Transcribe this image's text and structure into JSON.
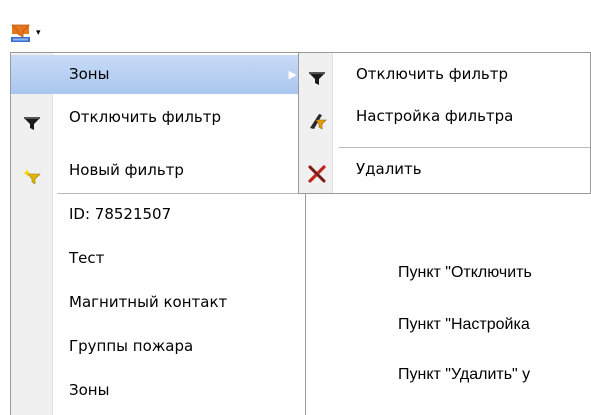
{
  "toolbar": {
    "filter_button_icon": "filter-dropdown-icon",
    "dropdown_arrow": "▾"
  },
  "main_menu": {
    "items": [
      {
        "label": "Зоны",
        "icon": "",
        "submenu_arrow": "▶",
        "active": true
      },
      {
        "label": "Отключить фильтр",
        "icon": "funnel-icon"
      },
      {
        "label": "Новый фильтр",
        "icon": "new-filter-icon"
      },
      {
        "label": "ID: 78521507",
        "icon": ""
      },
      {
        "label": "Тест",
        "icon": ""
      },
      {
        "label": "Магнитный контакт",
        "icon": ""
      },
      {
        "label": "Группы пожара",
        "icon": ""
      },
      {
        "label": "Зоны",
        "icon": ""
      }
    ]
  },
  "submenu": {
    "items": [
      {
        "label": "Отключить фильтр",
        "icon": "funnel-icon"
      },
      {
        "label": "Настройка фильтра",
        "icon": "filter-settings-icon"
      },
      {
        "label": "Удалить",
        "icon": "delete-x-icon"
      }
    ]
  },
  "document": {
    "lines": [
      "Пункт \"Отключить",
      "Пункт \"Настройка",
      "Пункт \"Удалить\" у"
    ]
  },
  "colors": {
    "highlight": "#b9d1f2",
    "gutter": "#f0f0f0",
    "border": "#9a9a9a",
    "filter_orange": "#e8761c",
    "filter_blue": "#3a6fd0",
    "delete_red": "#c0241c"
  }
}
